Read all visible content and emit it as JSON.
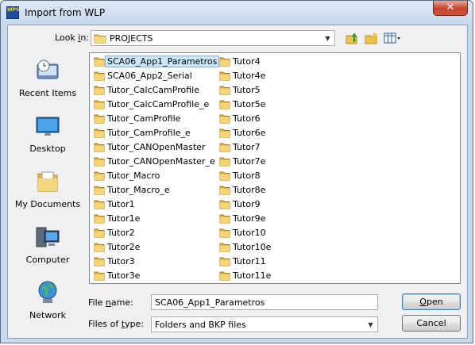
{
  "window": {
    "title": "Import from WLP",
    "app_icon_text": "WPS",
    "close_glyph": "✕"
  },
  "look_in": {
    "label": "Look in:",
    "value": "PROJECTS"
  },
  "toolbar": {
    "icons": [
      "up-folder-icon",
      "new-folder-icon",
      "view-menu-icon"
    ]
  },
  "places": [
    {
      "label": "Recent Items",
      "icon": "recent-items-icon"
    },
    {
      "label": "Desktop",
      "icon": "desktop-icon"
    },
    {
      "label": "My Documents",
      "icon": "my-documents-icon"
    },
    {
      "label": "Computer",
      "icon": "computer-icon"
    },
    {
      "label": "Network",
      "icon": "network-icon"
    }
  ],
  "files": {
    "col1": [
      "SCA06_App1_Parametros",
      "SCA06_App2_Serial",
      "Tutor_CalcCamProfile",
      "Tutor_CalcCamProfile_e",
      "Tutor_CamProfile",
      "Tutor_CamProfile_e",
      "Tutor_CANOpenMaster",
      "Tutor_CANOpenMaster_e",
      "Tutor_Macro",
      "Tutor_Macro_e",
      "Tutor1",
      "Tutor1e",
      "Tutor2",
      "Tutor2e",
      "Tutor3",
      "Tutor3e"
    ],
    "col2": [
      "Tutor4",
      "Tutor4e",
      "Tutor5",
      "Tutor5e",
      "Tutor6",
      "Tutor6e",
      "Tutor7",
      "Tutor7e",
      "Tutor8",
      "Tutor8e",
      "Tutor9",
      "Tutor9e",
      "Tutor10",
      "Tutor10e",
      "Tutor11",
      "Tutor11e"
    ],
    "selected": "SCA06_App1_Parametros"
  },
  "file_name": {
    "label": "File name:",
    "value": "SCA06_App1_Parametros"
  },
  "file_type": {
    "label": "Files of type:",
    "value": "Folders and BKP files"
  },
  "buttons": {
    "open": "Open",
    "cancel": "Cancel"
  }
}
